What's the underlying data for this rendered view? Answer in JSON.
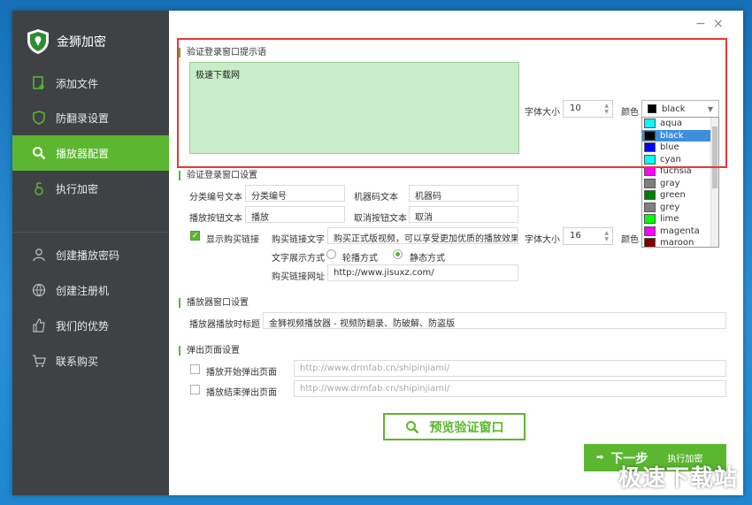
{
  "app": {
    "title": "金狮加密",
    "minimize": "−",
    "close": "×"
  },
  "sidebar": {
    "items": [
      {
        "label": "添加文件",
        "icon": "add-file-icon"
      },
      {
        "label": "防翻录设置",
        "icon": "shield-icon"
      },
      {
        "label": "播放器配置",
        "icon": "search-icon"
      },
      {
        "label": "执行加密",
        "icon": "lock-icon"
      },
      {
        "label": "创建播放密码",
        "icon": "user-icon"
      },
      {
        "label": "创建注册机",
        "icon": "globe-icon"
      },
      {
        "label": "我们的优势",
        "icon": "thumbs-up-icon"
      },
      {
        "label": "联系购买",
        "icon": "cart-icon"
      }
    ]
  },
  "prompt_section": {
    "title": "验证登录窗口提示语",
    "text": "极速下载网",
    "font_size_label": "字体大小",
    "font_size": "10",
    "color_label": "颜色",
    "color_selected": "black",
    "color_options": [
      {
        "name": "aqua",
        "hex": "#00ffff"
      },
      {
        "name": "black",
        "hex": "#000000"
      },
      {
        "name": "blue",
        "hex": "#0000ff"
      },
      {
        "name": "cyan",
        "hex": "#00ffff"
      },
      {
        "name": "fuchsia",
        "hex": "#ff00ff"
      },
      {
        "name": "gray",
        "hex": "#808080"
      },
      {
        "name": "green",
        "hex": "#008000"
      },
      {
        "name": "grey",
        "hex": "#808080"
      },
      {
        "name": "lime",
        "hex": "#00ff00"
      },
      {
        "name": "magenta",
        "hex": "#ff00ff"
      },
      {
        "name": "maroon",
        "hex": "#800000"
      }
    ]
  },
  "login_section": {
    "title": "验证登录窗口设置",
    "category_label": "分类编号文本",
    "category_value": "分类编号",
    "machine_label": "机器码文本",
    "machine_value": "机器码",
    "play_btn_label": "播放按钮文本",
    "play_btn_value": "播放",
    "cancel_btn_label": "取消按钮文本",
    "cancel_btn_value": "取消",
    "show_buy_label": "显示购买链接",
    "buy_text_label": "购买链接文字",
    "buy_text_value": "购买正式版视频，可以享受更加优质的播放效果",
    "font_size_label": "字体大小",
    "font_size": "16",
    "color_label": "颜色",
    "display_mode_label": "文字展示方式",
    "mode_scroll": "轮播方式",
    "mode_static": "静态方式",
    "buy_url_label": "购买链接网址",
    "buy_url_value": "http://www.jisuxz.com/"
  },
  "player_section": {
    "title": "播放器窗口设置",
    "caption_label": "播放器播放时标题",
    "caption_value": "金狮视频播放器 - 视频防翻录、防破解、防盗版"
  },
  "popup_section": {
    "title": "弹出页面设置",
    "start_label": "播放开始弹出页面",
    "start_placeholder": "http://www.drmfab.cn/shipinjiami/",
    "end_label": "播放结束弹出页面",
    "end_placeholder": "http://www.drmfab.cn/shipinjiami/"
  },
  "buttons": {
    "preview": "预览验证窗口",
    "next": "下一步",
    "next_sub": "执行加密"
  },
  "watermark": "极速下载站",
  "colors": {
    "accent": "#5bb72f",
    "sidebar": "#3f4245",
    "highlight_box": "#e53935",
    "textarea_bg": "#c9ecc9"
  }
}
